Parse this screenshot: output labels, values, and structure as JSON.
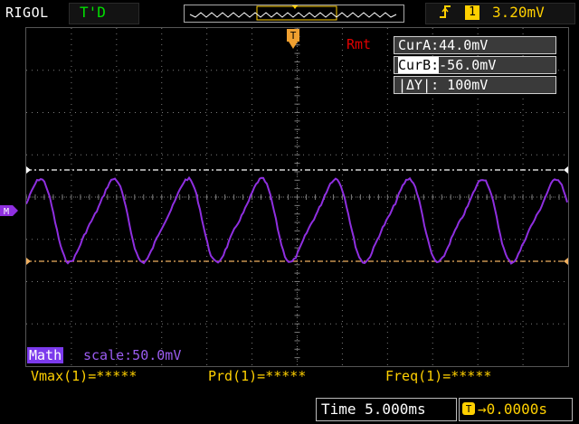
{
  "topbar": {
    "brand": "RIGOL",
    "run_status": "T'D",
    "trigger_edge_icon": "rising-edge-icon",
    "trigger_channel": "1",
    "trigger_level": "3.20mV"
  },
  "screen": {
    "remote_label": "Rmt",
    "cursor_a": "CurA:44.0mV",
    "cursor_b_label": "CurB:",
    "cursor_b_value": "-56.0mV",
    "cursor_delta": "|ΔY|: 100mV",
    "trigger_marker": "T",
    "math_marker": "M"
  },
  "math": {
    "tag": "Math",
    "scale": "scale:50.0mV"
  },
  "measurements": {
    "vmax": "Vmax(1)=*****",
    "prd": "Prd(1)=*****",
    "freq": "Freq(1)=*****"
  },
  "bottombar": {
    "timebase": "Time 5.000ms",
    "trigger_offset": "→0.0000s",
    "offset_marker": "T"
  },
  "colors": {
    "trace": "#8f2fe0",
    "cursor_a": "#ffffff",
    "cursor_b": "#f0b060",
    "grid": "#7a7a7a",
    "accent": "#ffd000"
  }
}
